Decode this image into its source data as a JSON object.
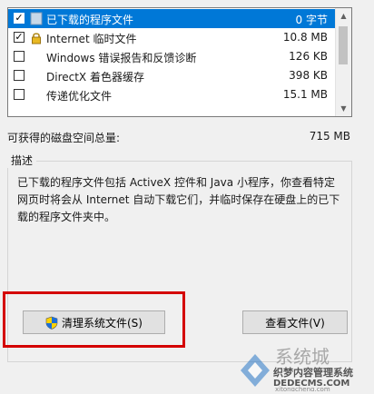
{
  "files": [
    {
      "name": "已下载的程序文件",
      "size": "0 字节",
      "checked": true,
      "selected": true,
      "icon": "folder-icon"
    },
    {
      "name": "Internet 临时文件",
      "size": "10.8 MB",
      "checked": true,
      "selected": false,
      "icon": "lock-icon"
    },
    {
      "name": "Windows 错误报告和反馈诊断",
      "size": "126 KB",
      "checked": false,
      "selected": false,
      "icon": "file-icon"
    },
    {
      "name": "DirectX 着色器缓存",
      "size": "398 KB",
      "checked": false,
      "selected": false,
      "icon": "file-icon"
    },
    {
      "name": "传递优化文件",
      "size": "15.1 MB",
      "checked": false,
      "selected": false,
      "icon": "file-icon"
    }
  ],
  "total": {
    "label": "可获得的磁盘空间总量:",
    "value": "715 MB"
  },
  "description": {
    "title": "描述",
    "text": "已下载的程序文件包括 ActiveX 控件和 Java 小程序，你查看特定网页时将会从 Internet 自动下载它们，并临时保存在硬盘上的已下载的程序文件夹中。"
  },
  "buttons": {
    "clean": "清理系统文件(S)",
    "view": "查看文件(V)"
  },
  "watermark": {
    "line1": "系统城",
    "line2": "织梦内容管理系统",
    "line3": "DEDECMS.COM",
    "line4": "xitongcheng.com"
  },
  "colors": {
    "selection": "#0078d7",
    "highlight": "#d40000"
  }
}
